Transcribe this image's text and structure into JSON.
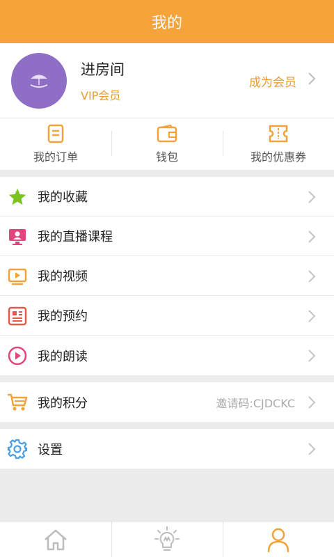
{
  "header": {
    "title": "我的"
  },
  "profile": {
    "name": "进房间",
    "vip": "VIP会员",
    "become_member": "成为会员"
  },
  "quick_actions": [
    {
      "label": "我的订单",
      "icon": "order-icon"
    },
    {
      "label": "钱包",
      "icon": "wallet-icon"
    },
    {
      "label": "我的优惠券",
      "icon": "coupon-icon"
    }
  ],
  "menu": [
    {
      "label": "我的收藏",
      "icon": "star-icon"
    },
    {
      "label": "我的直播课程",
      "icon": "live-class-icon"
    },
    {
      "label": "我的视频",
      "icon": "video-icon"
    },
    {
      "label": "我的预约",
      "icon": "reservation-icon"
    },
    {
      "label": "我的朗读",
      "icon": "play-circle-icon"
    }
  ],
  "points": {
    "label": "我的积分",
    "invite": "邀请码:CJDCKC",
    "icon": "cart-icon"
  },
  "settings": {
    "label": "设置",
    "icon": "gear-icon"
  },
  "tabbar": [
    {
      "name": "home-tab",
      "icon": "home-icon"
    },
    {
      "name": "discover-tab",
      "icon": "lightbulb-icon"
    },
    {
      "name": "profile-tab",
      "icon": "person-icon",
      "active": true
    }
  ],
  "colors": {
    "accent": "#f5a43a",
    "vip": "#e79b33",
    "avatar_bg": "#8f6fc6",
    "star": "#7cc520",
    "live": "#e0457e",
    "video": "#f1a33b",
    "reservation": "#e45a48",
    "play": "#e0457e",
    "cart": "#f1a33b",
    "gear": "#4a9fe0"
  }
}
